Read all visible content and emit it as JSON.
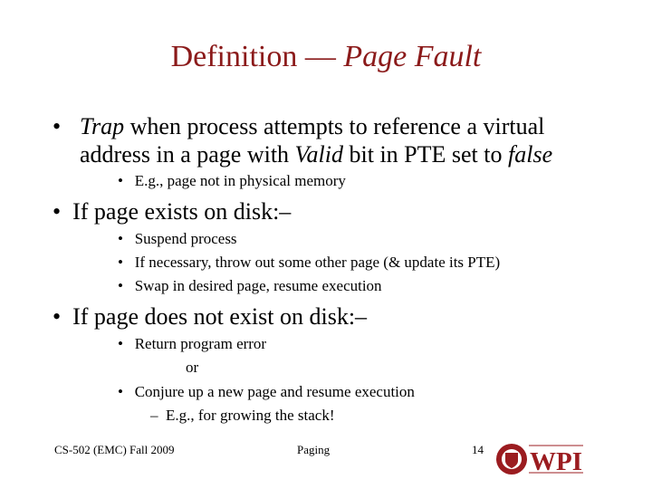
{
  "title": {
    "main": "Definition — ",
    "italic": "Page Fault"
  },
  "bullets": {
    "b1": {
      "i1": "Trap",
      "t1": " when process attempts to reference a virtual",
      "t2": "address in a page with ",
      "i2": "Valid",
      "t3": " bit in PTE set to ",
      "i3": "false"
    },
    "b1s1": "E.g., page not in physical memory",
    "b2": "If page exists on disk:–",
    "b2s": [
      "Suspend process",
      "If necessary, throw out some other page (& update its PTE)",
      "Swap in desired page, resume execution"
    ],
    "b3": "If page does not exist on disk:–",
    "b3s1": "Return program error",
    "or": "or",
    "b3s2": "Conjure up a new page and resume execution",
    "b3s2a": "E.g., for growing the stack!"
  },
  "footer": {
    "course": "CS-502 (EMC) Fall 2009",
    "topic": "Paging",
    "page": "14",
    "logo_text": "WPI"
  },
  "colors": {
    "title": "#8b1a1a",
    "logo": "#9b1c20"
  }
}
